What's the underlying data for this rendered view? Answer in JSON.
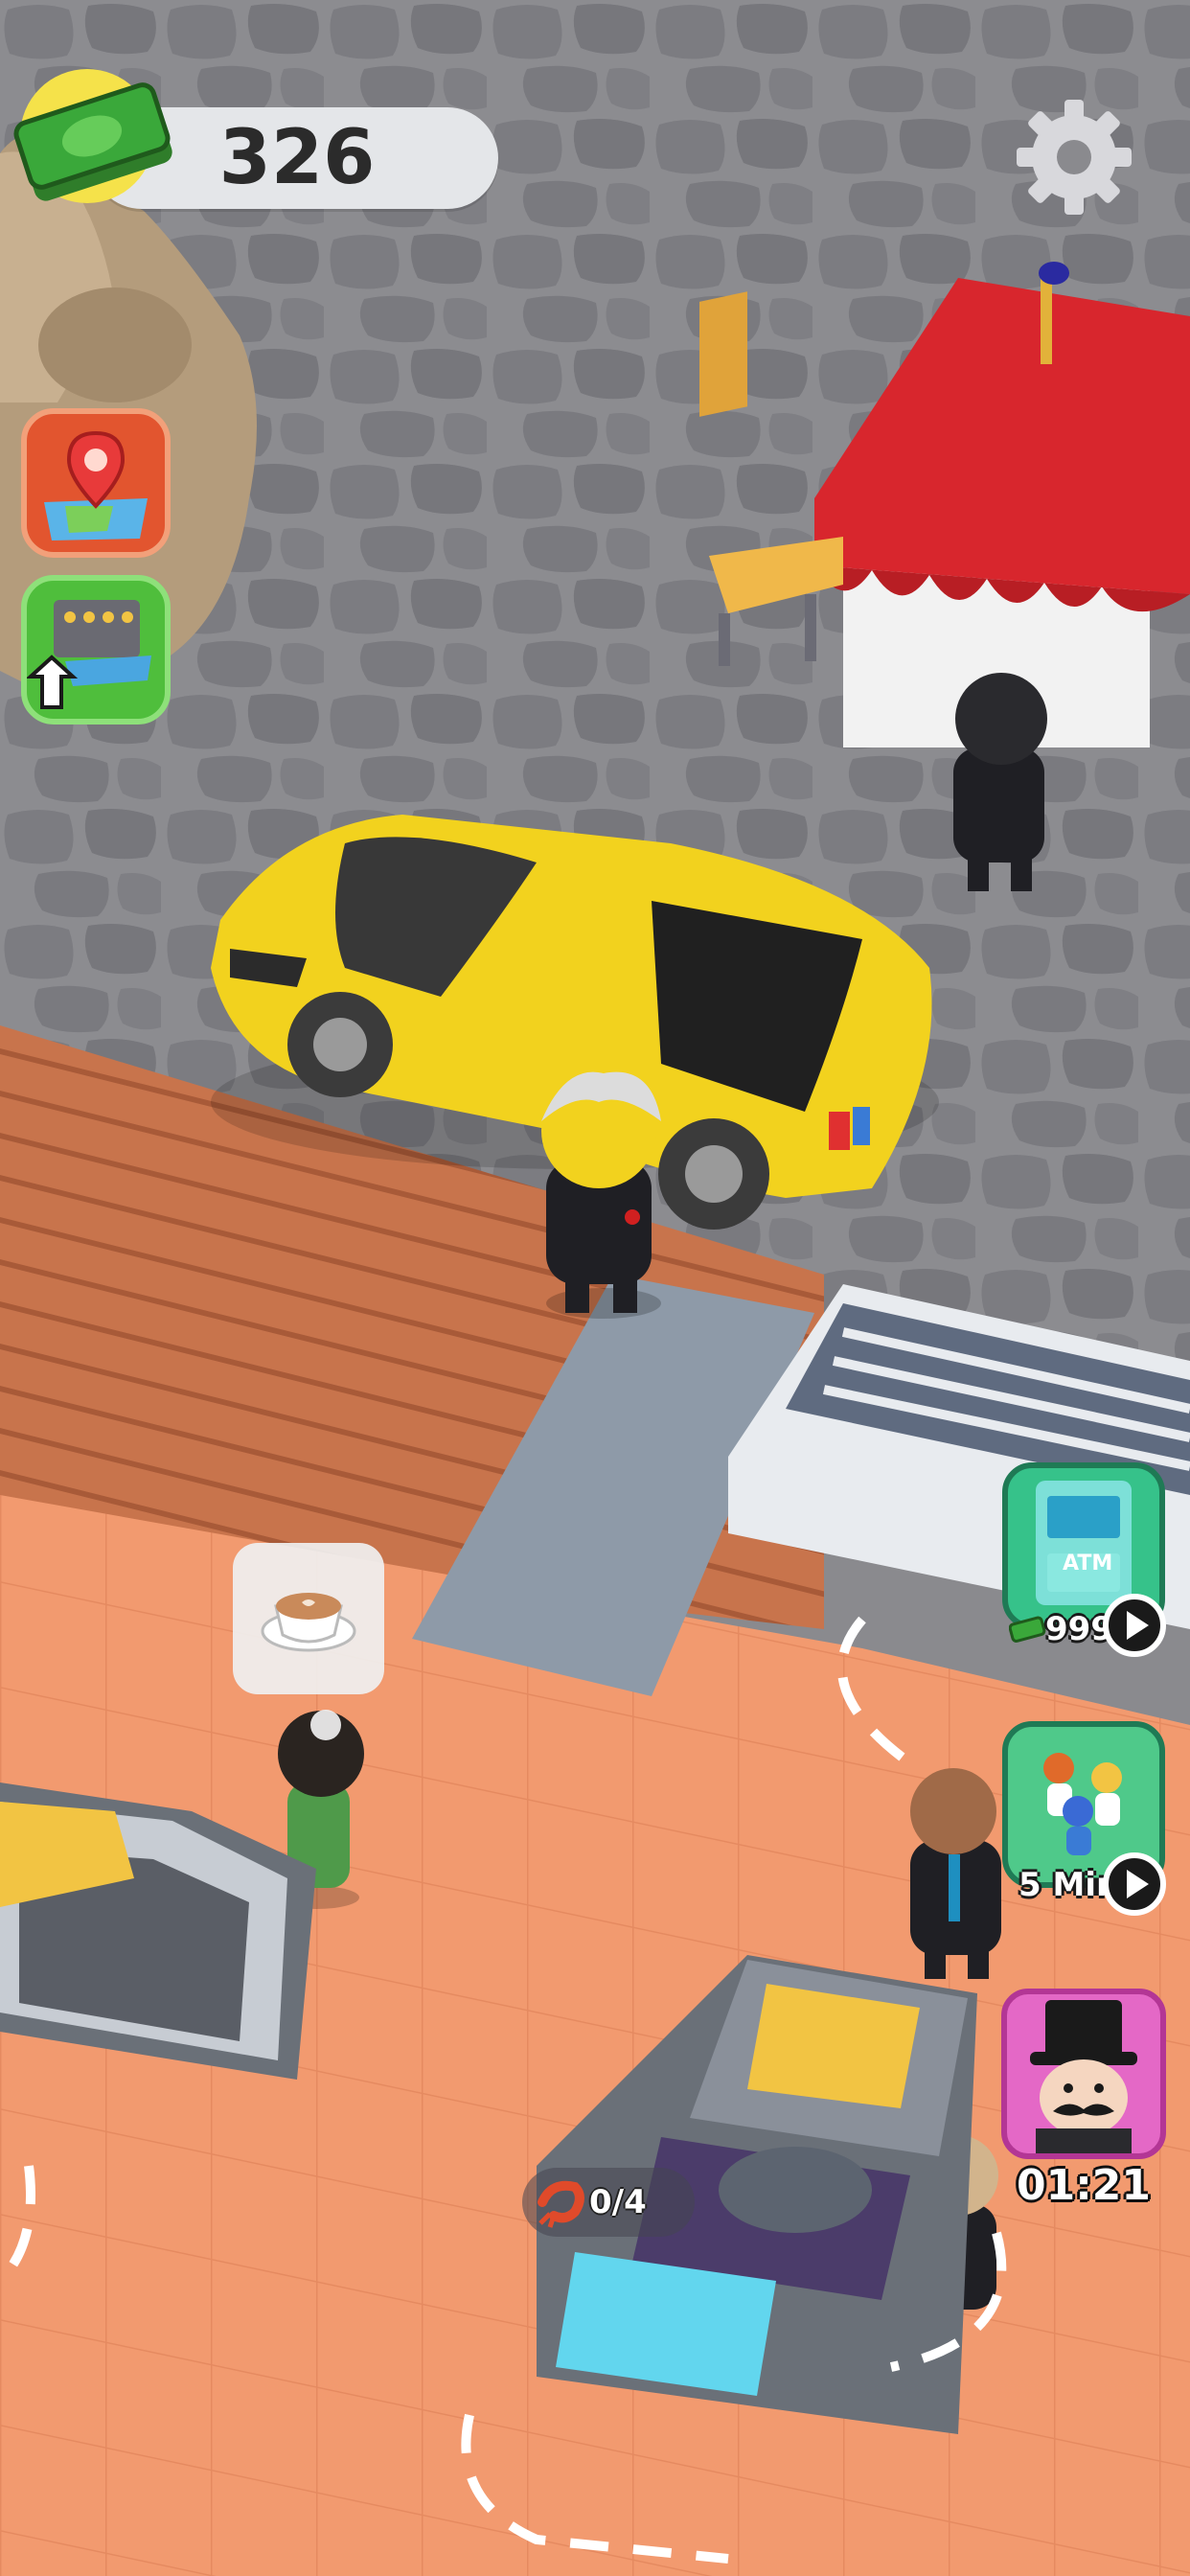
{
  "hud": {
    "cash": "326",
    "cash_icon": "cash-stack-icon",
    "settings_icon": "gear-icon"
  },
  "side_buttons": [
    {
      "name": "map-button",
      "icon": "map-pin-icon"
    },
    {
      "name": "upgrade-button",
      "icon": "upgrade-arrow-icon"
    }
  ],
  "ads": {
    "atm": {
      "screen_text": "ATM",
      "price": "999",
      "icon": "play-icon"
    },
    "staff": {
      "duration": "5 Min",
      "icon": "play-icon"
    }
  },
  "vip": {
    "timer": "01:21",
    "icon": "top-hat-customer-icon"
  },
  "order": {
    "item_icon": "coffee-cup-icon"
  },
  "station": {
    "progress": "0/4",
    "icon": "shrimp-icon"
  },
  "colors": {
    "cash_green": "#3aa83a",
    "street_stone": "#8a8a8e",
    "deck_wood": "#c8744c",
    "floor_tile": "#f29a6f",
    "car_yellow": "#f2d21e",
    "awning_red": "#d8262d",
    "vip_pink": "#e468c6"
  }
}
